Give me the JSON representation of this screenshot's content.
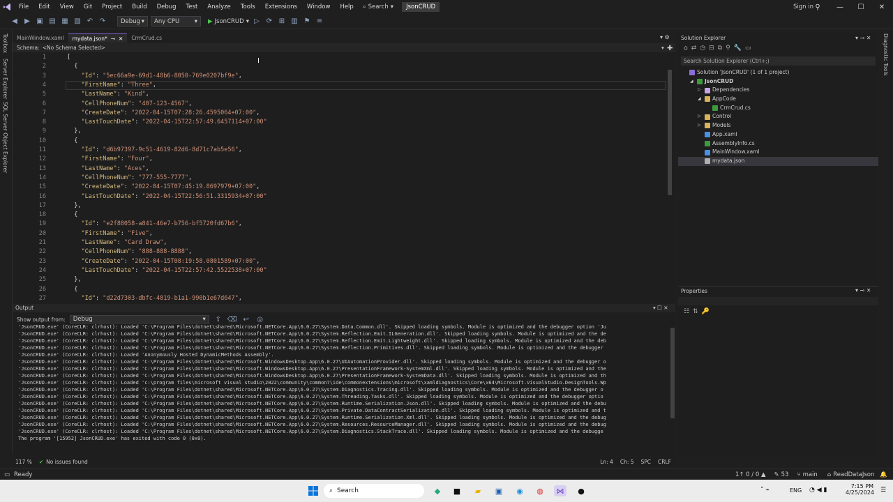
{
  "menu": [
    "File",
    "Edit",
    "View",
    "Git",
    "Project",
    "Build",
    "Debug",
    "Test",
    "Analyze",
    "Tools",
    "Extensions",
    "Window",
    "Help"
  ],
  "search_label": "Search",
  "solution_name": "JsonCRUD",
  "signin": "Sign in",
  "toolbar": {
    "config": "Debug",
    "platform": "Any CPU",
    "run_target": "JsonCRUD"
  },
  "side_tabs": {
    "toolbox": "Toolbox",
    "server_explorer": "Server Explorer",
    "sql_explorer": "SQL Server Object Explorer",
    "diagnostic": "Diagnostic Tools"
  },
  "tabs": [
    {
      "label": "MainWindow.xaml"
    },
    {
      "label": "mydata.json*"
    },
    {
      "label": "CrmCrud.cs"
    }
  ],
  "schema": {
    "label": "Schema:",
    "value": "<No Schema Selected>"
  },
  "code_lines": [
    {
      "n": "1",
      "t": "["
    },
    {
      "n": "2",
      "t": "  {"
    },
    {
      "n": "3",
      "t": "    \"Id\": \"5ec66a9e-69d1-48b6-8050-769e0207bf9e\","
    },
    {
      "n": "4",
      "t": "    \"FirstName\": \"Three\","
    },
    {
      "n": "5",
      "t": "    \"LastName\": \"Kind\","
    },
    {
      "n": "6",
      "t": "    \"CellPhoneNum\": \"407-123-4567\","
    },
    {
      "n": "7",
      "t": "    \"CreateDate\": \"2022-04-15T07:28:26.4595064+07:00\","
    },
    {
      "n": "8",
      "t": "    \"LastTouchDate\": \"2022-04-15T22:57:49.6457114+07:00\""
    },
    {
      "n": "9",
      "t": "  },"
    },
    {
      "n": "10",
      "t": "  {"
    },
    {
      "n": "11",
      "t": "    \"Id\": \"d6b97397-9c51-4619-82d6-8d71c7ab5e56\","
    },
    {
      "n": "12",
      "t": "    \"FirstName\": \"Four\","
    },
    {
      "n": "13",
      "t": "    \"LastName\": \"Aces\","
    },
    {
      "n": "14",
      "t": "    \"CellPhoneNum\": \"777-555-7777\","
    },
    {
      "n": "15",
      "t": "    \"CreateDate\": \"2022-04-15T07:45:19.8697979+07:00\","
    },
    {
      "n": "16",
      "t": "    \"LastTouchDate\": \"2022-04-15T22:56:51.3315934+07:00\""
    },
    {
      "n": "17",
      "t": "  },"
    },
    {
      "n": "18",
      "t": "  {"
    },
    {
      "n": "19",
      "t": "    \"Id\": \"e2f88058-a841-46e7-b756-bf5720fd67b6\","
    },
    {
      "n": "20",
      "t": "    \"FirstName\": \"Five\","
    },
    {
      "n": "21",
      "t": "    \"LastName\": \"Card Draw\","
    },
    {
      "n": "22",
      "t": "    \"CellPhoneNum\": \"888-888-8888\","
    },
    {
      "n": "23",
      "t": "    \"CreateDate\": \"2022-04-15T08:19:58.0801589+07:00\","
    },
    {
      "n": "24",
      "t": "    \"LastTouchDate\": \"2022-04-15T22:57:42.5522538+07:00\""
    },
    {
      "n": "25",
      "t": "  },"
    },
    {
      "n": "26",
      "t": "  {"
    },
    {
      "n": "27",
      "t": "    \"Id\": \"d22d7303-dbfc-4819-b1a1-990b1e67d647\","
    }
  ],
  "output": {
    "title": "Output",
    "show_from_label": "Show output from:",
    "show_from_value": "Debug",
    "lines": [
      "'JsonCRUD.exe' (CoreCLR: clrhost): Loaded 'C:\\Program Files\\dotnet\\shared\\Microsoft.NETCore.App\\6.0.27\\System.Data.Common.dll'. Skipped loading symbols. Module is optimized and the debugger option 'Ju",
      "'JsonCRUD.exe' (CoreCLR: clrhost): Loaded 'C:\\Program Files\\dotnet\\shared\\Microsoft.NETCore.App\\6.0.27\\System.Reflection.Emit.ILGeneration.dll'. Skipped loading symbols. Module is optimized and the de",
      "'JsonCRUD.exe' (CoreCLR: clrhost): Loaded 'C:\\Program Files\\dotnet\\shared\\Microsoft.NETCore.App\\6.0.27\\System.Reflection.Emit.Lightweight.dll'. Skipped loading symbols. Module is optimized and the deb",
      "'JsonCRUD.exe' (CoreCLR: clrhost): Loaded 'C:\\Program Files\\dotnet\\shared\\Microsoft.NETCore.App\\6.0.27\\System.Reflection.Primitives.dll'. Skipped loading symbols. Module is optimized and the debugger",
      "'JsonCRUD.exe' (CoreCLR: clrhost): Loaded 'Anonymously Hosted DynamicMethods Assembly'.",
      "'JsonCRUD.exe' (CoreCLR: clrhost): Loaded 'C:\\Program Files\\dotnet\\shared\\Microsoft.WindowsDesktop.App\\6.0.27\\UIAutomationProvider.dll'. Skipped loading symbols. Module is optimized and the debugger o",
      "'JsonCRUD.exe' (CoreCLR: clrhost): Loaded 'C:\\Program Files\\dotnet\\shared\\Microsoft.WindowsDesktop.App\\6.0.27\\PresentationFramework-SystemXml.dll'. Skipped loading symbols. Module is optimized and the",
      "'JsonCRUD.exe' (CoreCLR: clrhost): Loaded 'C:\\Program Files\\dotnet\\shared\\Microsoft.WindowsDesktop.App\\6.0.27\\PresentationFramework-SystemData.dll'. Skipped loading symbols. Module is optimized and th",
      "'JsonCRUD.exe' (CoreCLR: clrhost): Loaded 'c:\\program files\\microsoft visual studio\\2022\\community\\common7\\ide\\commonextensions\\microsoft\\xamldiagnostics\\Core\\x64\\Microsoft.VisualStudio.DesignTools.Wp",
      "'JsonCRUD.exe' (CoreCLR: clrhost): Loaded 'C:\\Program Files\\dotnet\\shared\\Microsoft.NETCore.App\\6.0.27\\System.Diagnostics.Tracing.dll'. Skipped loading symbols. Module is optimized and the debugger o",
      "'JsonCRUD.exe' (CoreCLR: clrhost): Loaded 'C:\\Program Files\\dotnet\\shared\\Microsoft.NETCore.App\\6.0.27\\System.Threading.Tasks.dll'. Skipped loading symbols. Module is optimized and the debugger optio",
      "'JsonCRUD.exe' (CoreCLR: clrhost): Loaded 'C:\\Program Files\\dotnet\\shared\\Microsoft.NETCore.App\\6.0.27\\System.Runtime.Serialization.Json.dll'. Skipped loading symbols. Module is optimized and the debu",
      "'JsonCRUD.exe' (CoreCLR: clrhost): Loaded 'C:\\Program Files\\dotnet\\shared\\Microsoft.NETCore.App\\6.0.27\\System.Private.DataContractSerialization.dll'. Skipped loading symbols. Module is optimized and t",
      "'JsonCRUD.exe' (CoreCLR: clrhost): Loaded 'C:\\Program Files\\dotnet\\shared\\Microsoft.NETCore.App\\6.0.27\\System.Runtime.Serialization.Xml.dll'. Skipped loading symbols. Module is optimized and the debug",
      "'JsonCRUD.exe' (CoreCLR: clrhost): Loaded 'C:\\Program Files\\dotnet\\shared\\Microsoft.NETCore.App\\6.0.27\\System.Resources.ResourceManager.dll'. Skipped loading symbols. Module is optimized and the debug",
      "'JsonCRUD.exe' (CoreCLR: clrhost): Loaded 'C:\\Program Files\\dotnet\\shared\\Microsoft.NETCore.App\\6.0.27\\System.Diagnostics.StackTrace.dll'. Skipped loading symbols. Module is optimized and the debugge",
      "The program '[15952] JsonCRUD.exe' has exited with code 0 (0x0)."
    ]
  },
  "editor_status": {
    "zoom": "117 %",
    "issues": "No issues found",
    "ln": "Ln: 4",
    "ch": "Ch: 5",
    "spc": "SPC",
    "crlf": "CRLF"
  },
  "solution_explorer": {
    "title": "Solution Explorer",
    "search_placeholder": "Search Solution Explorer (Ctrl+;)",
    "items": [
      {
        "label": "Solution 'JsonCRUD' (1 of 1 project)",
        "depth": 0,
        "icon": "solution-icon"
      },
      {
        "label": "JsonCRUD",
        "depth": 1,
        "icon": "csharp-project-icon"
      },
      {
        "label": "Dependencies",
        "depth": 2,
        "icon": "dependencies-icon"
      },
      {
        "label": "AppCode",
        "depth": 2,
        "icon": "folder-icon"
      },
      {
        "label": "CrmCrud.cs",
        "depth": 3,
        "icon": "csharp-file-icon"
      },
      {
        "label": "Control",
        "depth": 2,
        "icon": "folder-icon"
      },
      {
        "label": "Models",
        "depth": 2,
        "icon": "folder-icon"
      },
      {
        "label": "App.xaml",
        "depth": 2,
        "icon": "xaml-file-icon"
      },
      {
        "label": "AssemblyInfo.cs",
        "depth": 2,
        "icon": "csharp-file-icon"
      },
      {
        "label": "MainWindow.xaml",
        "depth": 2,
        "icon": "xaml-file-icon"
      },
      {
        "label": "mydata.json",
        "depth": 2,
        "icon": "json-file-icon"
      }
    ]
  },
  "properties_title": "Properties",
  "status": {
    "ready": "Ready",
    "updown": "1↑ 0 / 0 ▲",
    "pencil": "53",
    "branch": "main",
    "repo": "ReadDataJson"
  },
  "taskbar": {
    "search": "Search",
    "lang": "ENG",
    "time": "7:15 PM",
    "date": "4/25/2024"
  },
  "colors": {
    "accent": "#7a5fc8",
    "key": "#d7ba7d",
    "string": "#ce9178",
    "linenum": "#858585"
  }
}
